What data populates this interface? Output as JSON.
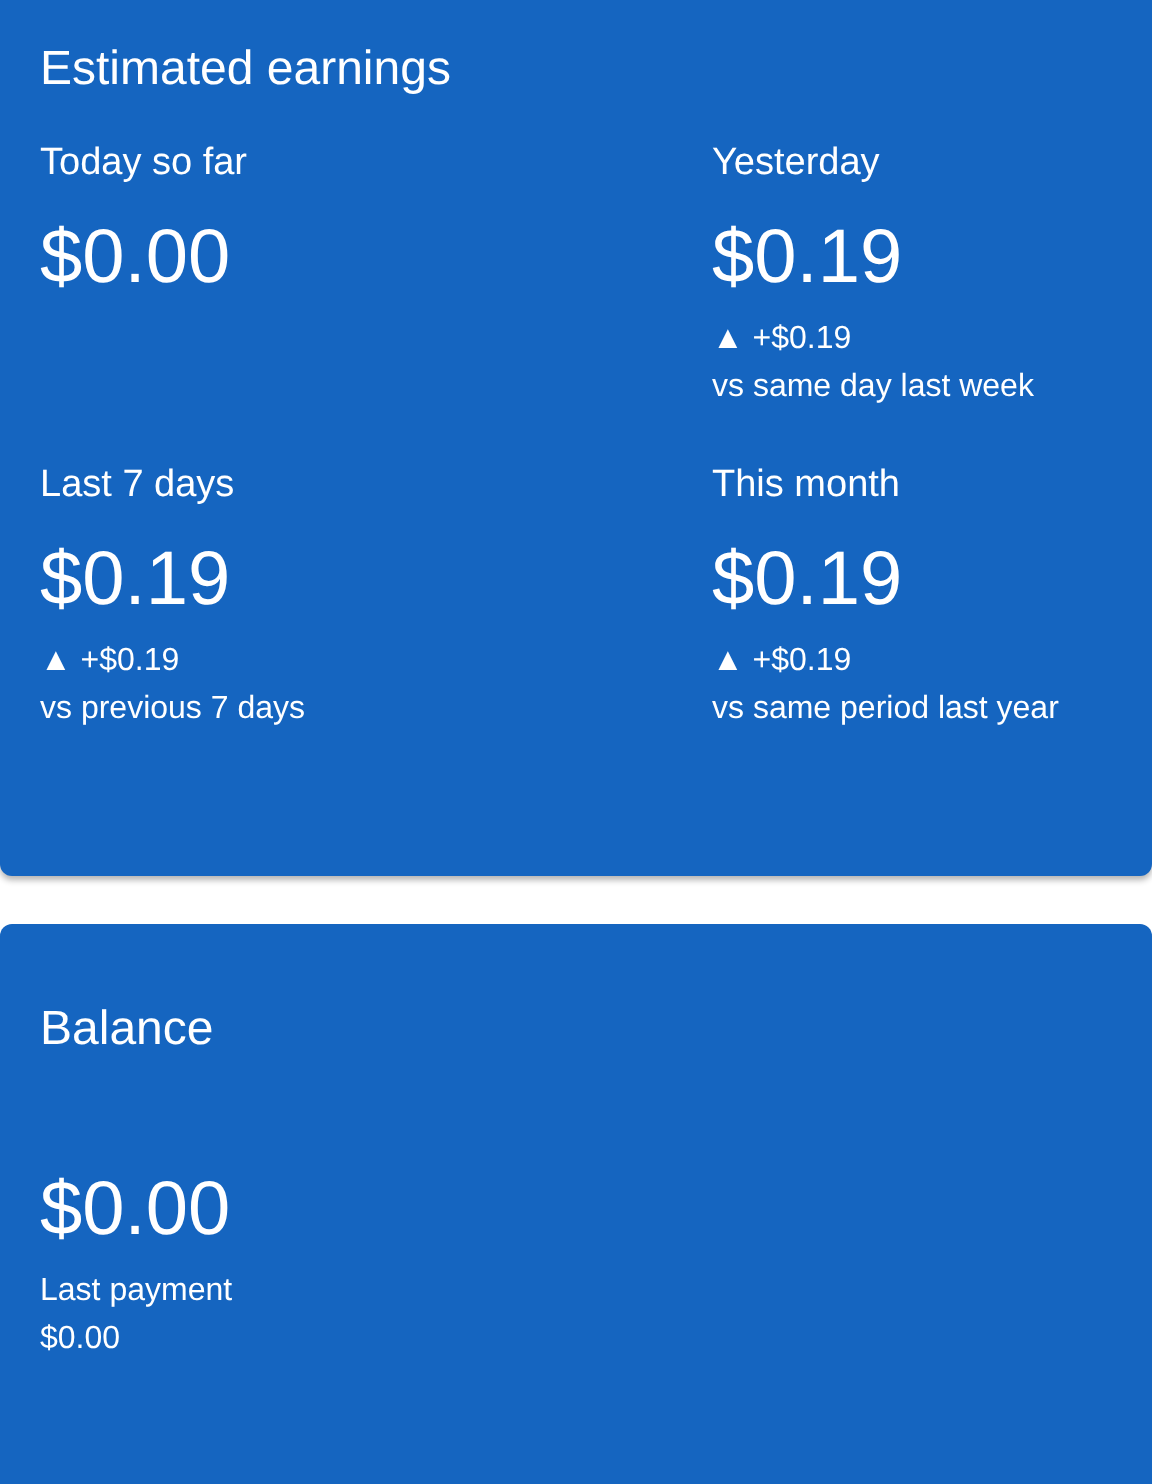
{
  "earnings": {
    "title": "Estimated earnings",
    "metrics": [
      {
        "label": "Today so far",
        "amount": "$0.00"
      },
      {
        "label": "Yesterday",
        "amount": "$0.19",
        "change": "▲ +$0.19",
        "comparison": "vs same day last week"
      },
      {
        "label": "Last 7 days",
        "amount": "$0.19",
        "change": "▲ +$0.19",
        "comparison": "vs previous 7 days"
      },
      {
        "label": "This month",
        "amount": "$0.19",
        "change": "▲ +$0.19",
        "comparison": "vs same period last year"
      }
    ]
  },
  "balance": {
    "title": "Balance",
    "amount": "$0.00",
    "last_payment_label": "Last payment",
    "last_payment_amount": "$0.00"
  }
}
